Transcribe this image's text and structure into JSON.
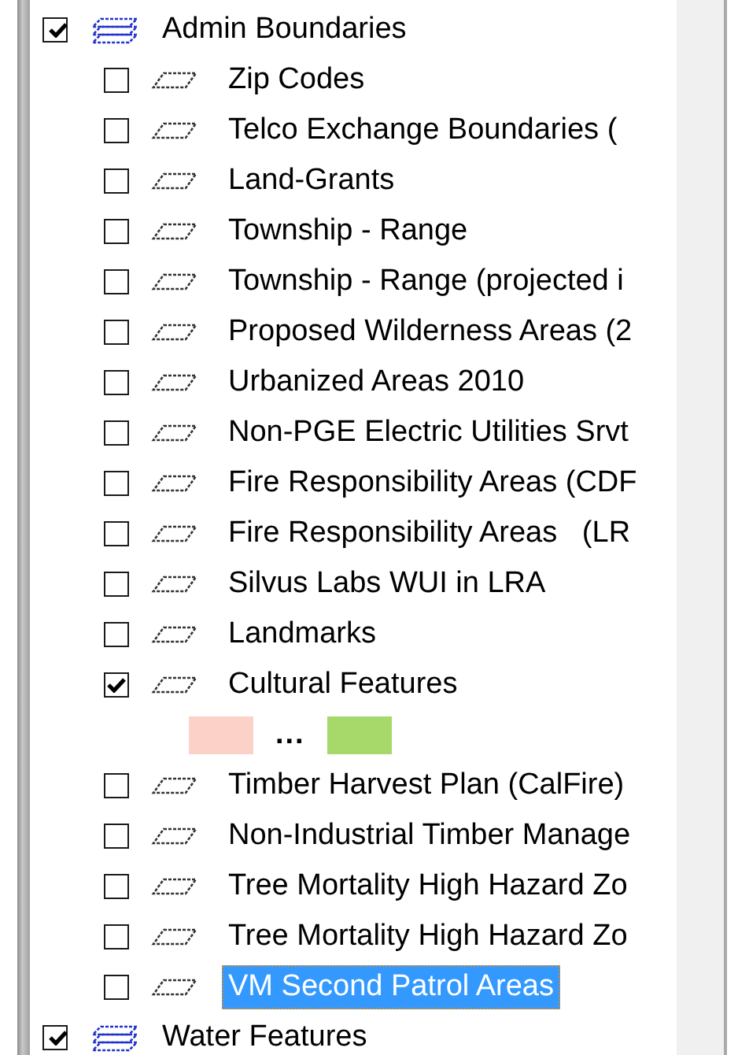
{
  "layers": [
    {
      "name": "Admin Boundaries",
      "checked": true,
      "selected": false,
      "children": [
        {
          "name": "Zip Codes",
          "checked": false,
          "selected": false
        },
        {
          "name": "Telco Exchange Boundaries (",
          "checked": false,
          "selected": false
        },
        {
          "name": "Land-Grants",
          "checked": false,
          "selected": false
        },
        {
          "name": "Township - Range",
          "checked": false,
          "selected": false
        },
        {
          "name": "Township - Range (projected i",
          "checked": false,
          "selected": false
        },
        {
          "name": "Proposed Wilderness Areas (2",
          "checked": false,
          "selected": false
        },
        {
          "name": "Urbanized Areas 2010",
          "checked": false,
          "selected": false
        },
        {
          "name": "Non-PGE Electric Utilities Srvt",
          "checked": false,
          "selected": false
        },
        {
          "name": "Fire Responsibility Areas (CDF",
          "checked": false,
          "selected": false
        },
        {
          "name": "Fire Responsibility Areas   (LR",
          "checked": false,
          "selected": false
        },
        {
          "name": "Silvus Labs WUI in LRA",
          "checked": false,
          "selected": false
        },
        {
          "name": "Landmarks",
          "checked": false,
          "selected": false
        },
        {
          "name": "Cultural Features",
          "checked": true,
          "selected": false,
          "legend": {
            "swatches": [
              {
                "color": "#fcd2c8"
              },
              {
                "color": "#a6d86a"
              }
            ],
            "ellipsis": "..."
          }
        },
        {
          "name": "Timber Harvest Plan (CalFire)",
          "checked": false,
          "selected": false
        },
        {
          "name": "Non-Industrial Timber Manage",
          "checked": false,
          "selected": false
        },
        {
          "name": "Tree Mortality High Hazard Zo",
          "checked": false,
          "selected": false
        },
        {
          "name": "Tree Mortality High Hazard Zo",
          "checked": false,
          "selected": false
        },
        {
          "name": "VM Second Patrol Areas",
          "checked": false,
          "selected": true
        }
      ]
    },
    {
      "name": "Water Features",
      "checked": true,
      "selected": false
    }
  ]
}
